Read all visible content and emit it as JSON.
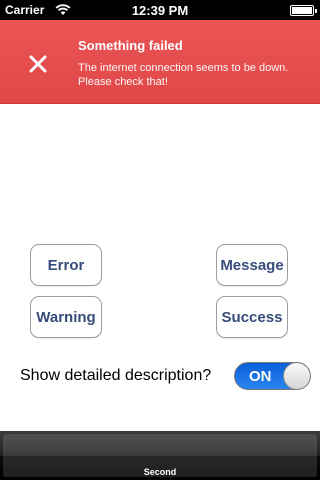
{
  "status_bar": {
    "carrier": "Carrier",
    "time": "12:39 PM"
  },
  "banner": {
    "title": "Something failed",
    "message": "The internet connection seems to be down. Please check that!",
    "color": "#e44f4f"
  },
  "buttons": {
    "error": "Error",
    "message": "Message",
    "warning": "Warning",
    "success": "Success"
  },
  "option": {
    "label": "Show detailed description?",
    "toggle_state": "ON"
  },
  "tab_bar": {
    "selected_label": "Second"
  },
  "icons": {
    "close": "close-icon",
    "wifi": "wifi-icon",
    "battery": "battery-icon"
  }
}
